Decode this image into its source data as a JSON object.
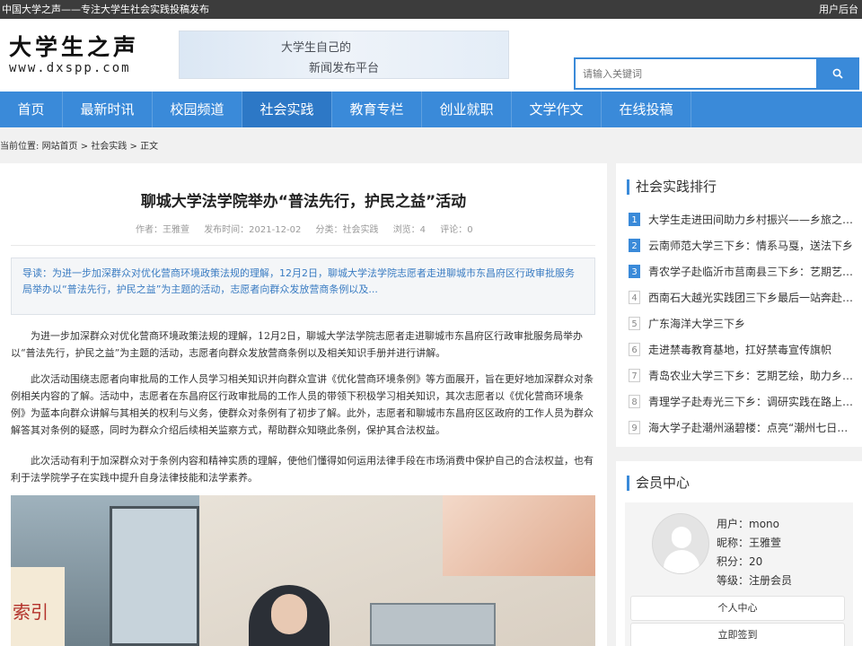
{
  "topbar": {
    "site_desc": "中国大学之声——专注大学生社会实践投稿发布",
    "admin_link": "用户后台"
  },
  "logo": {
    "main": "大学生之声",
    "sub": "www.dxspp.com"
  },
  "banner": {
    "line1": "大学生自己的",
    "line2": "新闻发布平台"
  },
  "search": {
    "placeholder": "请输入关键词",
    "icon": "search-icon"
  },
  "nav": {
    "items": [
      "首页",
      "最新时讯",
      "校园频道",
      "社会实践",
      "教育专栏",
      "创业就职",
      "文学作文",
      "在线投稿"
    ],
    "active_index": 3
  },
  "breadcrumb": {
    "prefix": "当前位置:",
    "home": "网站首页",
    "sep1": ">",
    "section": "社会实践",
    "sep2": ">",
    "current": "正文"
  },
  "article": {
    "title": "聊城大学法学院举办“普法先行，护民之益”活动",
    "author": "作者：王雅萱",
    "date": "发布时间：2021-12-02",
    "category": "分类：社会实践",
    "views": "浏览：4",
    "comments": "评论：0",
    "summary": "导读：为进一步加深群众对优化营商环境政策法规的理解，12月2日，聊城大学法学院志愿者走进聊城市东昌府区行政审批服务局举办以“普法先行，护民之益”为主题的活动，志愿者向群众发放营商条例以及...",
    "p1": "为进一步加深群众对优化营商环境政策法规的理解，12月2日，聊城大学法学院志愿者走进聊城市东昌府区行政审批服务局举办以“普法先行，护民之益”为主题的活动，志愿者向群众发放营商条例以及相关知识手册并进行讲解。",
    "p2": "此次活动围绕志愿者向审批局的工作人员学习相关知识并向群众宣讲《优化营商环境条例》等方面展开，旨在更好地加深群众对条例相关内容的了解。活动中，志愿者在东昌府区行政审批局的工作人员的带领下积极学习相关知识，其次志愿者以《优化营商环境条例》为蓝本向群众讲解与其相关的权利与义务，使群众对条例有了初步了解。此外，志愿者和聊城市东昌府区区政府的工作人员为群众解答其对条例的疑惑，同时为群众介绍后续相关监察方式，帮助群众知晓此条例，保护其合法权益。",
    "p3": "此次活动有利于加深群众对于条例内容和精神实质的理解，使他们懂得如何运用法律手段在市场消费中保护自己的合法权益，也有利于法学院学子在实践中提升自身法律技能和法学素养。",
    "photo_sign": "索引"
  },
  "rank": {
    "title": "社会实践排行",
    "items": [
      {
        "num": "1",
        "text": "大学生走进田间助力乡村振兴——乡旅之潮..."
      },
      {
        "num": "2",
        "text": "云南师范大学三下乡：情系马戛，送法下乡"
      },
      {
        "num": "3",
        "text": "青农学子赴临沂市莒南县三下乡：艺期艺绘..."
      },
      {
        "num": "4",
        "text": "西南石大越光实践团三下乡最后一站奔赴凉..."
      },
      {
        "num": "5",
        "text": "广东海洋大学三下乡"
      },
      {
        "num": "6",
        "text": "走进禁毒教育基地，扛好禁毒宣传旗帜"
      },
      {
        "num": "7",
        "text": "青岛农业大学三下乡：艺期艺绘，助力乡村..."
      },
      {
        "num": "8",
        "text": "青理学子赴寿光三下乡：调研实践在路上，..."
      },
      {
        "num": "9",
        "text": "海大学子赴潮州涵碧楼：点亮“潮州七日红”..."
      }
    ]
  },
  "member": {
    "title": "会员中心",
    "user": "用户：mono",
    "nickname": "昵称：王雅萱",
    "points": "积分：20",
    "level": "等级：注册会员",
    "btn_profile": "个人中心",
    "btn_checkin": "立即签到"
  }
}
